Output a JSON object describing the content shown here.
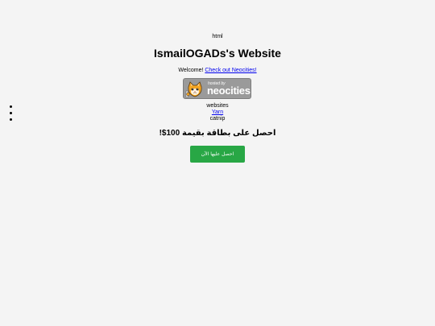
{
  "header": {
    "top_label": "html",
    "title": "IsmailOGADs's Website"
  },
  "welcome": {
    "text": "Welcome! ",
    "link_label": "Check out Neocities!"
  },
  "badge": {
    "small_text": "hosted by",
    "brand_text": "neocities",
    "icon": "neocities-cat-icon"
  },
  "list": {
    "items": [
      {
        "label": "websites",
        "link": false
      },
      {
        "label": "Yarn",
        "link": true
      },
      {
        "label": "catnip",
        "link": false
      }
    ]
  },
  "promo": {
    "text": "احصل على بطاقة بقيمة 100$!",
    "button_label": "احصل عليها الآن"
  },
  "colors": {
    "background": "#f4f4f4",
    "link": "#0000ee",
    "button": "#28a745",
    "badge": "#9a9a9a"
  }
}
